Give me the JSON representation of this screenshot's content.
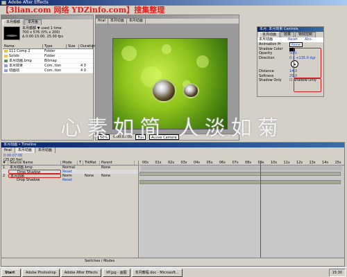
{
  "app": {
    "title": "Adobe After Effects"
  },
  "watermark_top": "【3lian.com 网络 YDZinfo.com】搜集整理",
  "watermark_mid": "心素如简 人淡如菊",
  "project": {
    "tabs": [
      "本月都都",
      "本月鱼"
    ],
    "info": [
      "本月都都 ▼ used 1 time",
      "700 x 576 (0% x 200)",
      "Δ 0:00:15:00, 25.00 fps"
    ],
    "columns": [
      "Name",
      "Type",
      "Size",
      "Duration"
    ],
    "items": [
      {
        "name": "111 Comp 2",
        "type": "Folder",
        "size": "",
        "duration": "",
        "icon": "folder-icon"
      },
      {
        "name": "Solids",
        "type": "Folder",
        "size": "",
        "duration": "",
        "icon": "folder-icon"
      },
      {
        "name": "本月动画.bmp",
        "type": "Bitmap",
        "size": "",
        "duration": "",
        "icon": "bitmap-icon"
      },
      {
        "name": "本月效果",
        "type": "Com..tion",
        "size": "",
        "duration": "4 0",
        "icon": "composition-icon"
      },
      {
        "name": "动画动",
        "type": "Com..tion",
        "size": "",
        "duration": "4 0",
        "icon": "composition-icon"
      }
    ]
  },
  "viewer": {
    "tabs": [
      "final",
      "本月动画",
      "本月动画"
    ],
    "bottom": [
      "50%",
      "0:00:07:00",
      "Full",
      "Active Camera"
    ]
  },
  "effects": {
    "title": "本月: 本月效果 Controls",
    "tabs": [
      "本月动画",
      "效果",
      "特效控制"
    ],
    "header": [
      "本月动画",
      "Reset",
      "Abo..."
    ],
    "rows": [
      {
        "label": "Animation Pr",
        "value": "None"
      },
      {
        "label": "Shadow Color",
        "value": ""
      },
      {
        "label": "Opacity",
        "value": "50%"
      },
      {
        "label": "Direction",
        "value": "0 x +135.0 dgr"
      },
      {
        "label": "",
        "value": ""
      },
      {
        "label": "",
        "value": ""
      },
      {
        "label": "Distance",
        "value": "14.0"
      },
      {
        "label": "Softness",
        "value": "25.0"
      },
      {
        "label": "Shadow Only",
        "value": "Shadow Only"
      }
    ]
  },
  "timeline": {
    "tabs": [
      "final",
      "本月动画",
      "本月动画"
    ],
    "time": [
      "0:00:07:00",
      "(25.00 fps)"
    ],
    "columns": [
      "#",
      "Source Name",
      "Mode",
      "T",
      "TrkMat",
      "Parent"
    ],
    "rows": [
      {
        "num": "1",
        "name": "本月动画.bmp",
        "mode": "Normal",
        "trk": "",
        "parent": "None",
        "selected": false
      },
      {
        "num": "",
        "name": "Drop Shadow",
        "mode": "Reset",
        "trk": "",
        "parent": "",
        "selected": true
      },
      {
        "num": "2",
        "name": "本月动画",
        "mode": "Norm",
        "trk": "None",
        "parent": "None",
        "selected": false
      },
      {
        "num": "",
        "name": "Drop Shadow",
        "mode": "Reset",
        "trk": "",
        "parent": "",
        "selected": false
      }
    ],
    "ruler": [
      "00s",
      "01s",
      "02s",
      "03s",
      "04s",
      "05s",
      "06s",
      "07s",
      "08s",
      "09s",
      "10s",
      "11s",
      "12s",
      "13s",
      "14s",
      "15s"
    ],
    "bottom": "Switches / Modes"
  },
  "taskbar": {
    "start": "Start",
    "items": [
      "Adobe Photoshop",
      "Adobe After Effects",
      "XP.jpg - 画图",
      "本月教程.doc - Microsoft..."
    ],
    "clock": "15:30"
  }
}
